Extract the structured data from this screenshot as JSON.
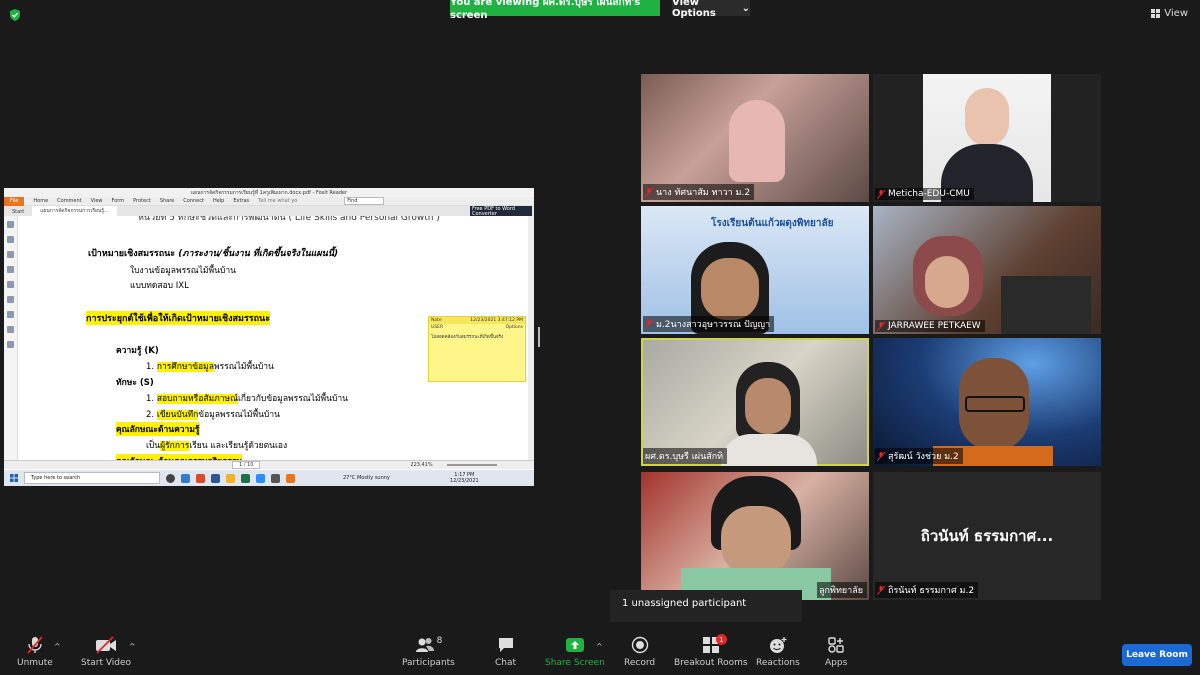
{
  "top": {
    "viewing_text": "You are viewing ผศ.ดร.บุษรี เผ่นสักทิ's screen",
    "view_options_label": "View Options",
    "view_label": "View"
  },
  "shared_window": {
    "title": "แผนการจัดกิจกรรมการเรียนรู้ที่ 1ครูเพิ่มเผาก.docx.pdf - Foxit Reader",
    "ribbon": [
      "File",
      "Home",
      "Comment",
      "View",
      "Form",
      "Protect",
      "Share",
      "Connect",
      "Help",
      "Extras"
    ],
    "tell_me": "Tell me what yo",
    "find_placeholder": "Find",
    "tabs": [
      "Start",
      "แผนการจัดกิจกรรมการเรียนรู้..."
    ],
    "converter_text": "Free PDF to Word Converter",
    "doc": {
      "line_top": "หน่วยที่ 5 ทักษะชีวิตและการพัฒนาตน ( Life Skills and Personal Growth )",
      "goal_title": "เป้าหมายเชิงสมรรถนะ",
      "goal_sub": "(ภาระงาน/ชิ้นงาน ที่เกิดขึ้นจริงในแผนนี้)",
      "goal_item1": "ใบงานข้อมูลพรรณไม้พื้นบ้าน",
      "goal_item2": "แบบทดสอบ IXL",
      "apply_title": "การประยุกต์ใช้เพื่อให้เกิดเป้าหมายเชิงสมรรถนะ",
      "k_title": "ความรู้ (K)",
      "k_item1_num": "1.",
      "k_item1_hl": "การศึกษาข้อมูล",
      "k_item1_rest": "พรรณไม้พื้นบ้าน",
      "s_title": "ทักษะ (S)",
      "s_item1_num": "1.",
      "s_item1_hl": "สอบถามหรือสัมภาษณ์",
      "s_item1_rest": "เกี่ยวกับข้อมูลพรรณไม้พื้นบ้าน",
      "s_item2_num": "2.",
      "s_item2_hl": "เขียนบันทึก",
      "s_item2_rest": "ข้อมูลพรรณไม้พื้นบ้าน",
      "a_title": "คุณลักษณะด้านความรู้",
      "a_item_pre": "เป็น",
      "a_item_hl": "ผู้รักการ",
      "a_item_rest": "เรียน และเรียนรู้ด้วยตนเอง",
      "cut_line": "คุณลักษณะด้านคุณธรรมจริยธรรม"
    },
    "note": {
      "label": "Note",
      "timestamp": "12/23/2021 3:47:12 PM",
      "user": "USER",
      "options": "Options",
      "body": "ไม่สอดคล้องกับสมรรถนะที่เกิดขึ้นจริง"
    },
    "status_page": "1 / 10",
    "status_zoom": "223.41%",
    "taskbar": {
      "search_placeholder": "Type here to search",
      "weather": "27°C  Mostly sunny",
      "time": "1:17 PM",
      "date": "12/23/2021"
    }
  },
  "participants": [
    {
      "name": "นาง ทัศนาสัม ทาวา ม.2",
      "muted": true
    },
    {
      "name": "Meticha-EDU-CMU",
      "muted": true
    },
    {
      "name": "ม.2นางสาวอุษาวรรณ ปัญญา",
      "muted": true
    },
    {
      "name": "JARRAWEE PETKAEW",
      "muted": true
    },
    {
      "name": "ผศ.ดร.บุษรี เผ่นสักทิ",
      "muted": false
    },
    {
      "name": "สุรัฒน์ วังช่วย ม.2",
      "muted": true
    },
    {
      "name": "ลูกพิทยาลัย",
      "muted": false
    },
    {
      "name": "ถิรนันท์ ธรรมกาศ ม.2",
      "muted": true,
      "placeholder": "ถิวนันท์ ธรรมกาศ..."
    }
  ],
  "banner_school": "โรงเรียนต้นแก้วผดุงพิทยาลัย",
  "tooltip": "1 unassigned participant",
  "toolbar": {
    "unmute": "Unmute",
    "start_video": "Start Video",
    "participants": "Participants",
    "participants_count": "8",
    "chat": "Chat",
    "share_screen": "Share Screen",
    "record": "Record",
    "breakout": "Breakout Rooms",
    "breakout_badge": "1",
    "reactions": "Reactions",
    "apps": "Apps",
    "leave": "Leave Room"
  },
  "colors": {
    "accent_green": "#1fb141",
    "leave_blue": "#1b6ad4",
    "active_border": "#d1d448",
    "highlight_yellow": "#fff200"
  }
}
